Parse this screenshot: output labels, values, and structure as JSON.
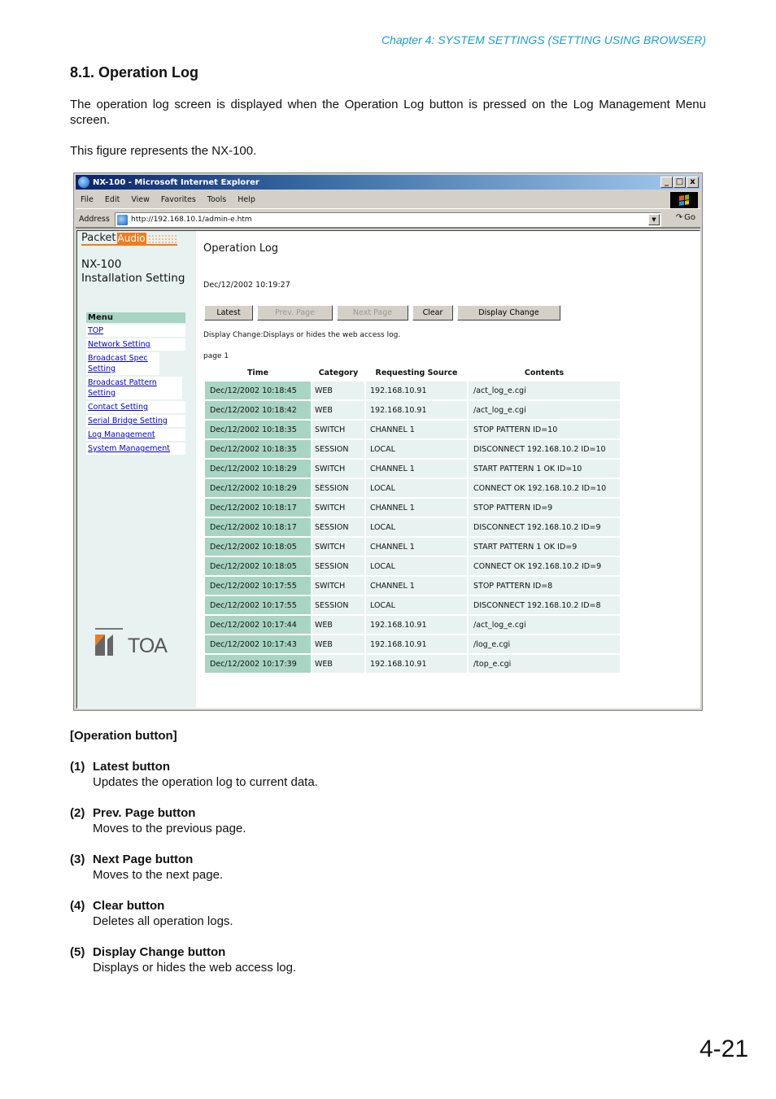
{
  "header": {
    "chapter": "Chapter 4:  SYSTEM SETTINGS (SETTING USING BROWSER)",
    "section_title": "8.1. Operation Log",
    "intro": "The operation log screen is displayed when the Operation Log button is pressed on the Log Management Menu screen.",
    "figure_note": "This figure represents the NX-100."
  },
  "browser": {
    "title": "NX-100 - Microsoft Internet Explorer",
    "window_buttons": [
      "_",
      "□",
      "x"
    ],
    "menu": [
      "File",
      "Edit",
      "View",
      "Favorites",
      "Tools",
      "Help"
    ],
    "address_label": "Address",
    "address_value": "http://192.168.10.1/admin-e.htm",
    "go_label": "Go"
  },
  "sidebar": {
    "logo_packet": "Packet",
    "logo_audio": "Audio",
    "model": "NX-100",
    "subtitle": "Installation Setting",
    "menu_heading": "Menu",
    "menu_items": [
      "TOP",
      "Network Setting",
      "Broadcast Spec Setting",
      "Broadcast Pattern Setting",
      "Contact Setting",
      "Serial Bridge Setting",
      "Log Management",
      "System Management"
    ],
    "brand": "TOA"
  },
  "main": {
    "title": "Operation Log",
    "timestamp": "Dec/12/2002 10:19:27",
    "buttons": {
      "latest": "Latest",
      "prev": "Prev. Page",
      "next": "Next Page",
      "clear": "Clear",
      "display_change": "Display Change"
    },
    "display_change_note": "Display Change:Displays or hides the web access log.",
    "page_label": "page 1",
    "columns": [
      "Time",
      "Category",
      "Requesting Source",
      "Contents"
    ],
    "rows": [
      [
        "Dec/12/2002 10:18:45",
        "WEB",
        "192.168.10.91",
        "/act_log_e.cgi"
      ],
      [
        "Dec/12/2002 10:18:42",
        "WEB",
        "192.168.10.91",
        "/act_log_e.cgi"
      ],
      [
        "Dec/12/2002 10:18:35",
        "SWITCH",
        "CHANNEL 1",
        "STOP PATTERN ID=10"
      ],
      [
        "Dec/12/2002 10:18:35",
        "SESSION",
        "LOCAL",
        "DISCONNECT 192.168.10.2 ID=10"
      ],
      [
        "Dec/12/2002 10:18:29",
        "SWITCH",
        "CHANNEL 1",
        "START PATTERN 1 OK ID=10"
      ],
      [
        "Dec/12/2002 10:18:29",
        "SESSION",
        "LOCAL",
        "CONNECT OK 192.168.10.2 ID=10"
      ],
      [
        "Dec/12/2002 10:18:17",
        "SWITCH",
        "CHANNEL 1",
        "STOP PATTERN ID=9"
      ],
      [
        "Dec/12/2002 10:18:17",
        "SESSION",
        "LOCAL",
        "DISCONNECT 192.168.10.2 ID=9"
      ],
      [
        "Dec/12/2002 10:18:05",
        "SWITCH",
        "CHANNEL 1",
        "START PATTERN 1 OK ID=9"
      ],
      [
        "Dec/12/2002 10:18:05",
        "SESSION",
        "LOCAL",
        "CONNECT OK 192.168.10.2 ID=9"
      ],
      [
        "Dec/12/2002 10:17:55",
        "SWITCH",
        "CHANNEL 1",
        "STOP PATTERN ID=8"
      ],
      [
        "Dec/12/2002 10:17:55",
        "SESSION",
        "LOCAL",
        "DISCONNECT 192.168.10.2 ID=8"
      ],
      [
        "Dec/12/2002 10:17:44",
        "WEB",
        "192.168.10.91",
        "/act_log_e.cgi"
      ],
      [
        "Dec/12/2002 10:17:43",
        "WEB",
        "192.168.10.91",
        "/log_e.cgi"
      ],
      [
        "Dec/12/2002 10:17:39",
        "WEB",
        "192.168.10.91",
        "/top_e.cgi"
      ]
    ]
  },
  "operations": {
    "heading": "[Operation button]",
    "items": [
      {
        "num": "(1)",
        "title": "Latest button",
        "desc": "Updates the operation log to current data."
      },
      {
        "num": "(2)",
        "title": "Prev. Page button",
        "desc": "Moves to the previous page."
      },
      {
        "num": "(3)",
        "title": "Next Page button",
        "desc": "Moves to the next page."
      },
      {
        "num": "(4)",
        "title": "Clear button",
        "desc": "Deletes all operation logs."
      },
      {
        "num": "(5)",
        "title": "Display Change button",
        "desc": "Displays or hides the web access log."
      }
    ]
  },
  "page_number": "4-21",
  "colors": {
    "chapter_text": "#1a9fd0",
    "table_time_bg": "#a8d4c4",
    "table_cell_bg": "#e8f2f0",
    "brand_orange": "#f07c1e"
  }
}
